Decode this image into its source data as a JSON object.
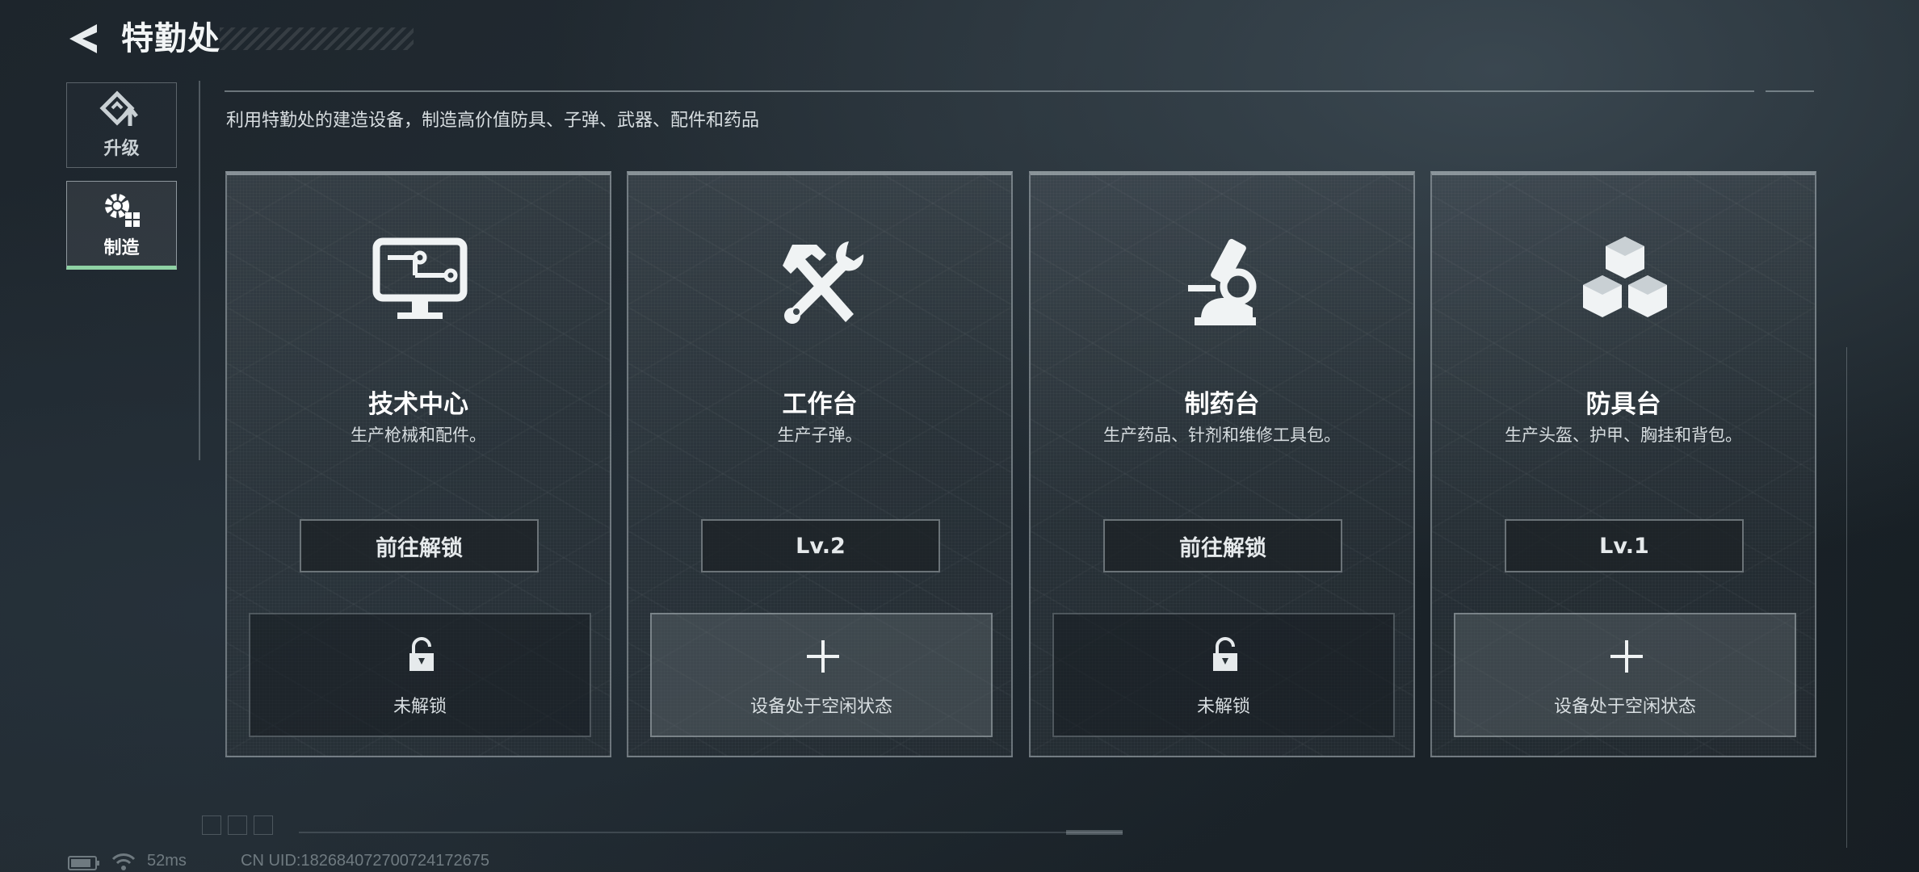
{
  "header": {
    "title": "特勤处",
    "back_icon": "back-arrow-icon"
  },
  "sidebar": {
    "items": [
      {
        "label": "升级",
        "icon": "upgrade-icon",
        "active": false
      },
      {
        "label": "制造",
        "icon": "gears-icon",
        "active": true
      }
    ]
  },
  "main": {
    "description": "利用特勤处的建造设备，制造高价值防具、子弹、武器、配件和药品",
    "cards": [
      {
        "name": "技术中心",
        "desc": "生产枪械和配件。",
        "icon": "computer-icon",
        "button": "前往解锁",
        "slot_text": "未解锁",
        "slot_icon": "lock-icon"
      },
      {
        "name": "工作台",
        "desc": "生产子弹。",
        "icon": "hammer-wrench-icon",
        "button": "Lv.2",
        "slot_text": "设备处于空闲状态",
        "slot_icon": "plus-icon"
      },
      {
        "name": "制药台",
        "desc": "生产药品、针剂和维修工具包。",
        "icon": "microscope-icon",
        "button": "前往解锁",
        "slot_text": "未解锁",
        "slot_icon": "lock-icon"
      },
      {
        "name": "防具台",
        "desc": "生产头盔、护甲、胸挂和背包。",
        "icon": "cubes-icon",
        "button": "Lv.1",
        "slot_text": "设备处于空闲状态",
        "slot_icon": "plus-icon"
      }
    ]
  },
  "status_bar": {
    "ping": "52ms",
    "uid": "CN UID:1826840727007241726​75"
  },
  "colors": {
    "active_tab_accent": "#8fd2a4",
    "background": "#1d252c"
  }
}
